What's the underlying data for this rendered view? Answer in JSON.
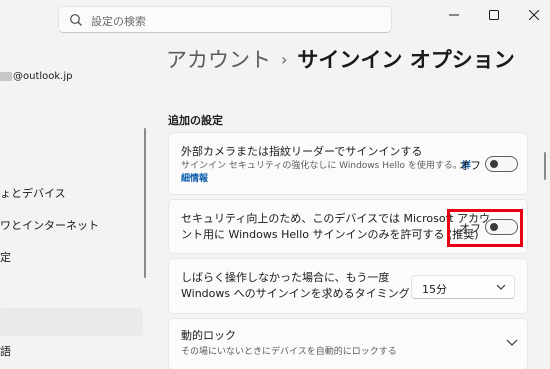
{
  "search": {
    "placeholder": "設定の検索"
  },
  "sidebar": {
    "email_suffix": "@outlook.jp",
    "items": [
      {
        "label": "ょとデバイス"
      },
      {
        "label": "ワとインターネット"
      },
      {
        "label": "定"
      },
      {
        "label": "語"
      }
    ]
  },
  "page": {
    "breadcrumb_parent": "アカウント",
    "breadcrumb_separator": "›",
    "title": "サインイン オプション"
  },
  "section": {
    "heading": "追加の設定"
  },
  "settings": {
    "external_camera": {
      "title": "外部カメラまたは指紋リーダーでサインインする",
      "desc_line1": "サインイン セキュリティの強化なしに Windows Hello を使用する。",
      "link_part1": "詳",
      "link_part2": "細情報",
      "state": "オフ"
    },
    "hello_only": {
      "title_line1": "セキュリティ向上のため、このデバイスでは Microsoft アカウ",
      "title_line2": "ント用に Windows Hello サインインのみを許可する (推奨)",
      "state": "オフ"
    },
    "resign_timing": {
      "title_line1": "しばらく操作しなかった場合に、もう一度",
      "title_line2": "Windows へのサインインを求めるタイミング",
      "value": "15分"
    },
    "dynamic_lock": {
      "title": "動的ロック",
      "desc": "その場にいないときにデバイスを自動的にロックする"
    }
  },
  "colors": {
    "highlight": "#e60012",
    "link": "#0b5cad",
    "background": "#f3f3f3"
  }
}
